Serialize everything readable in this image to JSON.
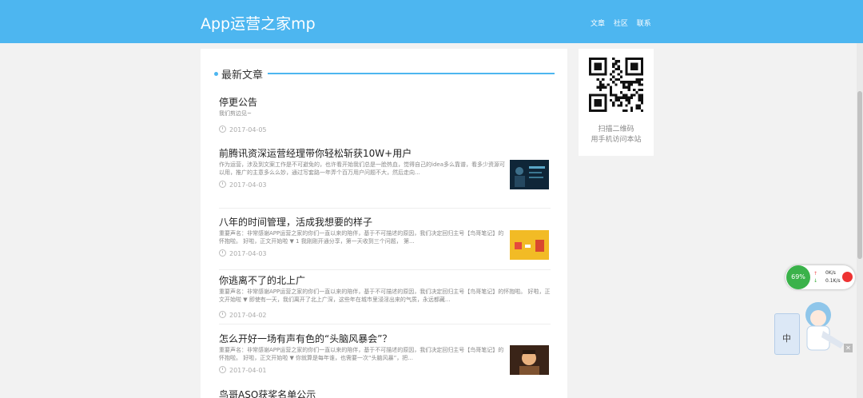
{
  "header": {
    "site_title": "App运营之家mp",
    "nav": [
      "文章",
      "社区",
      "联系"
    ]
  },
  "section": {
    "title": "最新文章"
  },
  "articles": [
    {
      "title": "停更公告",
      "summary": "我们剪边见~",
      "date": "2017-04-05"
    },
    {
      "title": "前腾讯资深运营经理带你轻松斩获10W+用户",
      "summary": "作为运营，涉及到文案工作是不可避免的，也许看开始我们总是一脸热血，觉得自己的idea多么靠谱，看多少资源可以用，推广的主意多么么妙，通过写套路一年弄个百万用户问题不大，然后走向...",
      "date": "2017-04-03"
    },
    {
      "title": "八年的时间管理，活成我想要的样子",
      "summary": "重要声名：非常感谢APP运营之家的你们一直以来的陪伴，基于不可描述的原因，我们决定回归主号【鸟哥笔记】的怀抱啦。 好啦，正文开始啦 ▼ 1 我刚刚开通分享，第一天收到三个问题， 第...",
      "date": "2017-04-03"
    },
    {
      "title": "你逃离不了的北上广",
      "summary": "重要声名：非常感谢APP运营之家的你们一直以来的陪伴，基于不可描述的原因，我们决定回归主号【鸟哥笔记】的怀抱啦。 好啦，正文开始啦 ▼ 即使有一天，我们离开了北上广深，这些年在城市里浸淫出来的气质，永远都藏...",
      "date": "2017-04-02"
    },
    {
      "title": "怎么开好一场有声有色的“头脑风暴会”？",
      "summary": "重要声名：非常感谢APP运营之家的你们一直以来的陪伴，基于不可描述的原因，我们决定回归主号【鸟哥笔记】的怀抱啦。 好啦，正文开始啦 ▼ 你就算是每年谁，也需要一次“头脑风暴”，把...",
      "date": "2017-04-01"
    },
    {
      "title": "鸟哥ASO获奖名单公示"
    }
  ],
  "sidebar": {
    "qr_caption_1": "扫描二维码",
    "qr_caption_2": "用手机访问本站"
  },
  "widget": {
    "percent": "69%",
    "upload": "0K/s",
    "download": "0.1K/s",
    "ime_char": "中"
  }
}
